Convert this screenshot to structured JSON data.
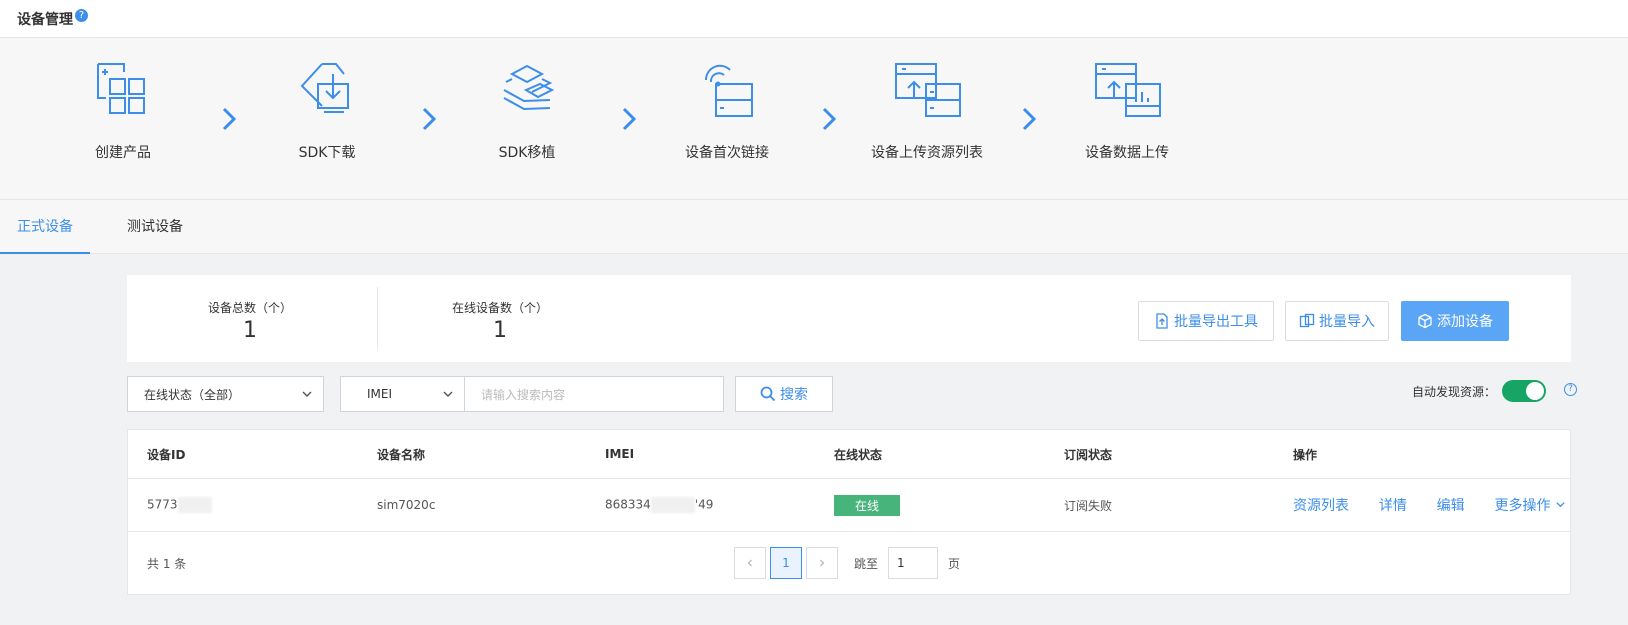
{
  "header": {
    "title": "设备管理",
    "help": "?"
  },
  "steps": [
    {
      "label": "创建产品",
      "icon": "create-product-icon"
    },
    {
      "label": "SDK下载",
      "icon": "sdk-download-icon"
    },
    {
      "label": "SDK移植",
      "icon": "sdk-port-icon"
    },
    {
      "label": "设备首次链接",
      "icon": "device-first-connect-icon"
    },
    {
      "label": "设备上传资源列表",
      "icon": "upload-resource-list-icon"
    },
    {
      "label": "设备数据上传",
      "icon": "device-data-upload-icon"
    }
  ],
  "tabs": [
    {
      "label": "正式设备",
      "active": true
    },
    {
      "label": "测试设备",
      "active": false
    }
  ],
  "stats": {
    "total_label": "设备总数（个）",
    "total_value": "1",
    "online_label": "在线设备数（个）",
    "online_value": "1"
  },
  "actions": {
    "export_tool": "批量导出工具",
    "batch_import": "批量导入",
    "add_device": "添加设备"
  },
  "filter": {
    "status_select": "在线状态（全部）",
    "field_select": "IMEI",
    "search_placeholder": "请输入搜索内容",
    "search_button": "搜索",
    "autodiscover_label": "自动发现资源：",
    "autodiscover_on": true
  },
  "table": {
    "columns": [
      "设备ID",
      "设备名称",
      "IMEI",
      "在线状态",
      "订阅状态",
      "操作"
    ],
    "rows": [
      {
        "device_id": "5773",
        "name": "sim7020c",
        "imei_prefix": "868334",
        "imei_suffix": "'49",
        "status": "在线",
        "subscription": "订阅失败",
        "ops": [
          "资源列表",
          "详情",
          "编辑",
          "更多操作"
        ]
      }
    ]
  },
  "pagination": {
    "total": "共 1 条",
    "current_page": "1",
    "goto_label": "跳至",
    "goto_value": "1",
    "page_unit": "页"
  },
  "colors": {
    "accent": "#3d8eea",
    "primary_button": "#5aa5f5",
    "online": "#47b47b",
    "toggle_on": "#16a565"
  }
}
